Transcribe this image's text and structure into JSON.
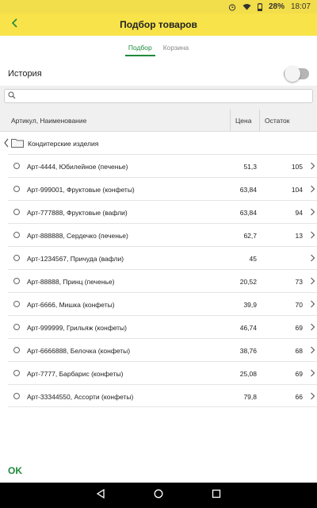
{
  "status": {
    "battery": "28%",
    "time": "18:07"
  },
  "header": {
    "title": "Подбор товаров"
  },
  "tabs": [
    {
      "label": "Подбор"
    },
    {
      "label": "Корзина"
    }
  ],
  "history": {
    "label": "История",
    "enabled": false
  },
  "search": {
    "value": "",
    "placeholder": ""
  },
  "table": {
    "columns": [
      "Артикул, Наименование",
      "Цена",
      "Остаток"
    ],
    "group": "Кондитерские изделия",
    "rows": [
      {
        "name": "Арт-4444, Юбилейное (печенье)",
        "price": "51,3",
        "stock": "105"
      },
      {
        "name": "Арт-999001, Фруктовые (конфеты)",
        "price": "63,84",
        "stock": "104"
      },
      {
        "name": "Арт-777888, Фруктовые (вафли)",
        "price": "63,84",
        "stock": "94"
      },
      {
        "name": "Арт-888888, Сердечко (печенье)",
        "price": "62,7",
        "stock": "13"
      },
      {
        "name": "Арт-1234567, Причуда (вафли)",
        "price": "45",
        "stock": ""
      },
      {
        "name": "Арт-88888, Принц (печенье)",
        "price": "20,52",
        "stock": "73"
      },
      {
        "name": "Арт-6666, Мишка (конфеты)",
        "price": "39,9",
        "stock": "70"
      },
      {
        "name": "Арт-999999, Грильяж (конфеты)",
        "price": "46,74",
        "stock": "69"
      },
      {
        "name": "Арт-6666888, Белочка (конфеты)",
        "price": "38,76",
        "stock": "68"
      },
      {
        "name": "Арт-7777, Барбарис (конфеты)",
        "price": "25,08",
        "stock": "69"
      },
      {
        "name": "Арт-33344550, Ассорти (конфеты)",
        "price": "79,8",
        "stock": "66"
      }
    ]
  },
  "footer": {
    "ok_label": "OK"
  },
  "colors": {
    "accent": "#1f8a3b",
    "appbar": "#f8e34a"
  }
}
